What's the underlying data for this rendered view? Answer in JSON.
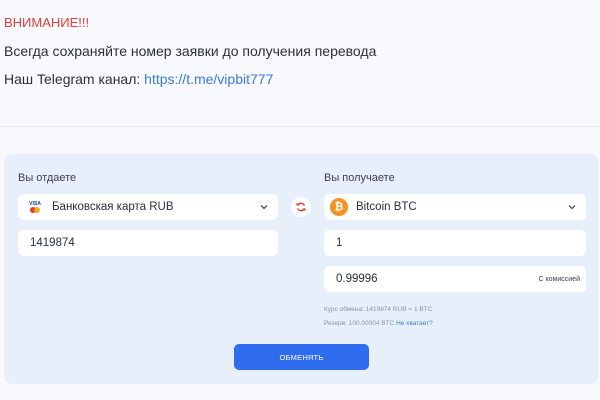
{
  "notice": {
    "warning": "ВНИМАНИЕ!!!",
    "keep_text": "Всегда сохраняйте номер заявки до получения перевода",
    "telegram_label": "Наш Telegram канал: ",
    "telegram_link": "https://t.me/vipbit777"
  },
  "exchange": {
    "give": {
      "label": "Вы отдаете",
      "currency": "Банковская карта RUB",
      "amount": "1419874",
      "icon": "visa-mastercard-icon"
    },
    "get": {
      "label": "Вы получаете",
      "currency": "Bitcoin BTC",
      "amount": "1",
      "result": "0.99996",
      "commission_label": "С комиссией",
      "icon": "bitcoin-icon"
    },
    "rate_text": "Курс обмена: 1419874 RUB = 1 BTC",
    "reserve_text": "Резерв: 100.00004 BTC ",
    "reserve_link": "Не хватает?",
    "submit_label": "ОБМЕНЯТЬ"
  },
  "colors": {
    "warning": "#d9423b",
    "link": "#3a7bd5",
    "accent": "#2f6cf0",
    "panel": "#e7effb",
    "bitcoin": "#f39322"
  }
}
